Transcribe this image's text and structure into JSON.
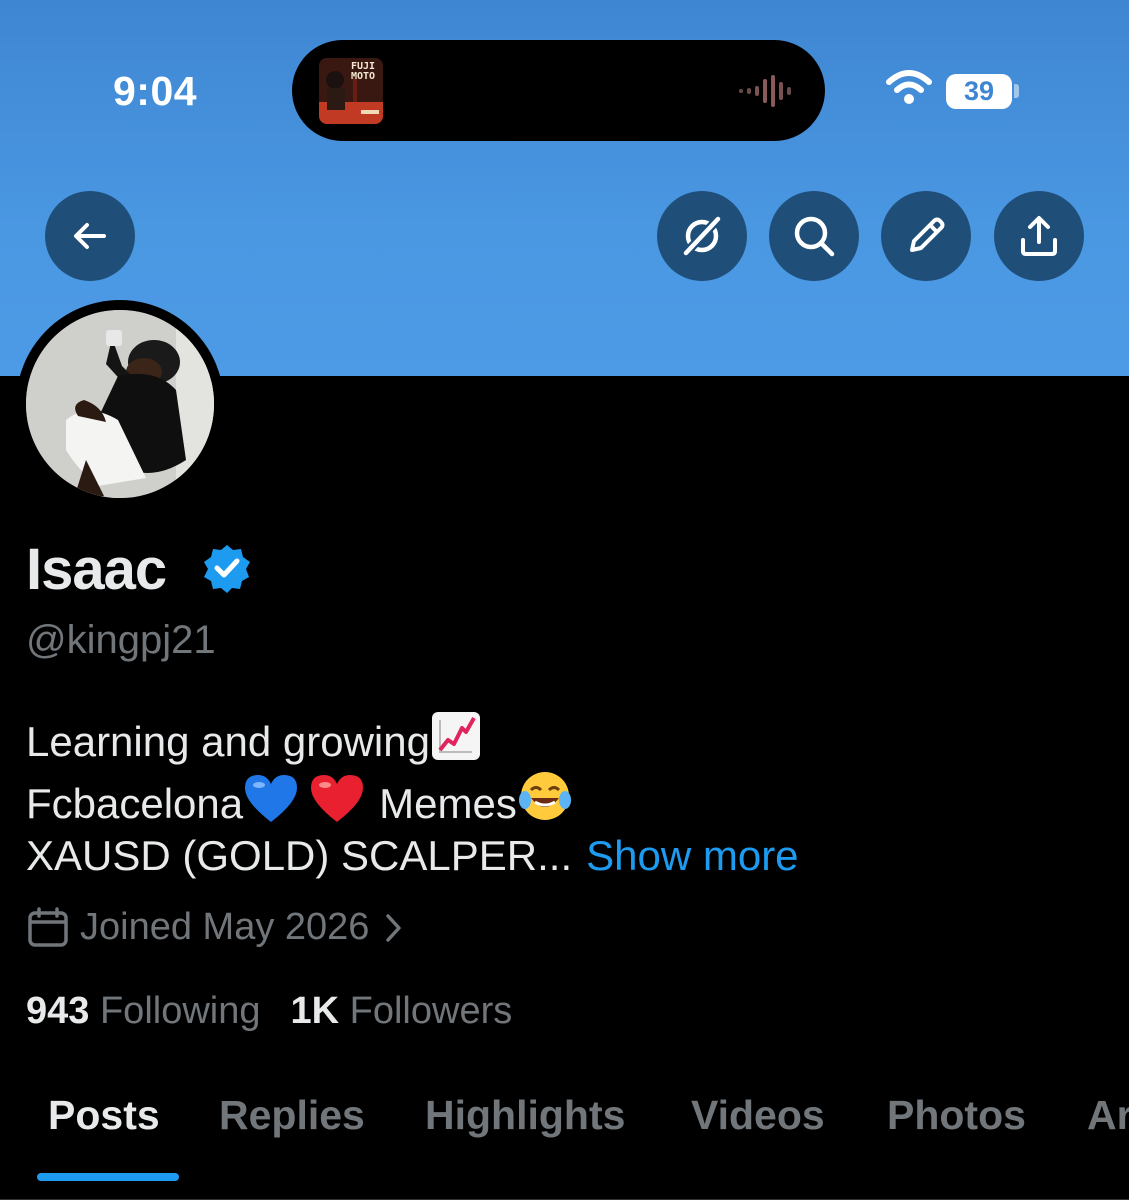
{
  "status_bar": {
    "time": "9:04",
    "battery": "39",
    "now_playing_art_text": "FUJI MOTO"
  },
  "header": {
    "back_icon": "arrow-left-icon",
    "actions": [
      {
        "name": "grok-icon"
      },
      {
        "name": "search-icon"
      },
      {
        "name": "pencil-icon"
      },
      {
        "name": "share-icon"
      }
    ]
  },
  "profile": {
    "display_name": "Isaac",
    "verified": true,
    "handle": "@kingpj21",
    "bio": {
      "line1": "Learning and growing",
      "line2a": "Fcbacelona",
      "line2b": "Memes",
      "line3": "XAUSD (GOLD) SCALPER...",
      "show_more": "Show more"
    },
    "joined": "Joined May 2026",
    "following_count": "943",
    "following_label": "Following",
    "followers_count": "1K",
    "followers_label": "Followers"
  },
  "tabs": [
    "Posts",
    "Replies",
    "Highlights",
    "Videos",
    "Photos",
    "Ar"
  ],
  "colors": {
    "accent": "#1d9bf0",
    "banner": "#4a97e2",
    "muted_text": "#71767b",
    "button_bg": "#1f4f78"
  }
}
